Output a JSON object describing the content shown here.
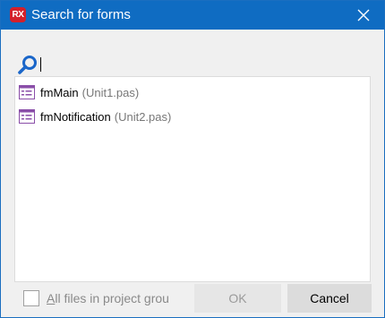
{
  "window": {
    "title": "Search for forms",
    "app_badge": "RX",
    "close_symbol": "✕"
  },
  "search": {
    "value": "",
    "placeholder": ""
  },
  "results": [
    {
      "name": "fmMain",
      "unit": "(Unit1.pas)"
    },
    {
      "name": "fmNotification",
      "unit": "(Unit2.pas)"
    }
  ],
  "footer": {
    "checkbox_accel": "A",
    "checkbox_rest": "ll files in project grou",
    "checkbox_checked": false,
    "ok_label": "OK",
    "cancel_label": "Cancel"
  },
  "colors": {
    "titlebar": "#0f6cc2",
    "accent": "#1a66c9",
    "form_icon": "#8a4ea8"
  }
}
